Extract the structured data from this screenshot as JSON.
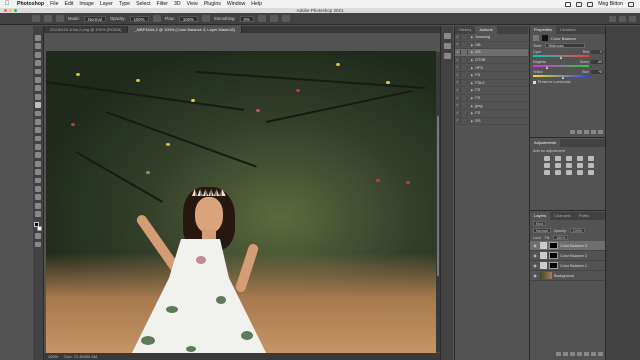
{
  "menubar": {
    "app_name": "Photoshop",
    "items": [
      "File",
      "Edit",
      "Image",
      "Layer",
      "Type",
      "Select",
      "Filter",
      "3D",
      "View",
      "Plugins",
      "Window",
      "Help"
    ],
    "user": "Meg Bitton"
  },
  "window_title": "Adobe Photoshop 2021",
  "options_bar": {
    "mode_label": "Mode:",
    "mode_value": "Normal",
    "opacity_label": "Opacity:",
    "opacity_value": "100%",
    "flow_label": "Flow:",
    "flow_value": "100%",
    "smoothing_label": "Smoothing:",
    "smoothing_value": "0%"
  },
  "tabs": [
    {
      "label": "20240419-1nhs-2.png @ 100% (RGB/8)",
      "active": false
    },
    {
      "label": "_MBP1644-2 @ 100% (Color Balance 3, Layer Mask/16)",
      "active": true
    }
  ],
  "status_bar": {
    "zoom": "100%",
    "doc": "Doc: 72.4M/90.4M"
  },
  "history_panel": {
    "tabs": [
      "History",
      "Actions"
    ],
    "active_tab": "Actions",
    "rows": [
      {
        "label": "Amazing",
        "checked": true,
        "selected": false
      },
      {
        "label": "DB",
        "checked": true,
        "selected": false
      },
      {
        "label": "DS",
        "checked": true,
        "selected": true
      },
      {
        "label": "DTSB",
        "checked": true,
        "selected": false
      },
      {
        "label": "HFS",
        "checked": true,
        "selected": false
      },
      {
        "label": "FS",
        "checked": true,
        "selected": false
      },
      {
        "label": "FSLV",
        "checked": true,
        "selected": false
      },
      {
        "label": "FS",
        "checked": true,
        "selected": false
      },
      {
        "label": "FS",
        "checked": true,
        "selected": false
      },
      {
        "label": "jpeg",
        "checked": true,
        "selected": false
      },
      {
        "label": "FS",
        "checked": true,
        "selected": false
      },
      {
        "label": "RS",
        "checked": true,
        "selected": false
      }
    ]
  },
  "properties_panel": {
    "tabs": [
      "Properties",
      "Libraries"
    ],
    "active_tab": "Properties",
    "title": "Color Balance",
    "tone_label": "Tone:",
    "tone_value": "Midtones",
    "sliders": [
      {
        "left": "Cyan",
        "right": "Red",
        "value": "0",
        "position": 0.5,
        "gradient": "linear-gradient(90deg,#00c8d0,#ff3a2a)"
      },
      {
        "left": "Magenta",
        "right": "Green",
        "value": "-49",
        "position": 0.255,
        "gradient": "linear-gradient(90deg,#e02ce0,#2ad040)"
      },
      {
        "left": "Yellow",
        "right": "Blue",
        "value": "+8",
        "position": 0.54,
        "gradient": "linear-gradient(90deg,#f0e020,#2a40ff)"
      }
    ],
    "preserve_label": "Preserve Luminosity"
  },
  "adjustments_panel": {
    "tabs": [
      "Adjustments"
    ],
    "add_label": "Add an adjustment"
  },
  "layers_panel": {
    "tabs": [
      "Layers",
      "Channels",
      "Paths"
    ],
    "active_tab": "Layers",
    "kind_label": "Kind",
    "blend_mode": "Normal",
    "opacity_label": "Opacity:",
    "opacity_value": "100%",
    "lock_label": "Lock:",
    "fill_label": "Fill:",
    "fill_value": "100%",
    "layers": [
      {
        "name": "Color Balance 3",
        "selected": true,
        "type": "adjustment"
      },
      {
        "name": "Color Balance 2",
        "selected": false,
        "type": "adjustment"
      },
      {
        "name": "Color Balance 1",
        "selected": false,
        "type": "adjustment"
      },
      {
        "name": "Background",
        "selected": false,
        "type": "image"
      }
    ]
  }
}
